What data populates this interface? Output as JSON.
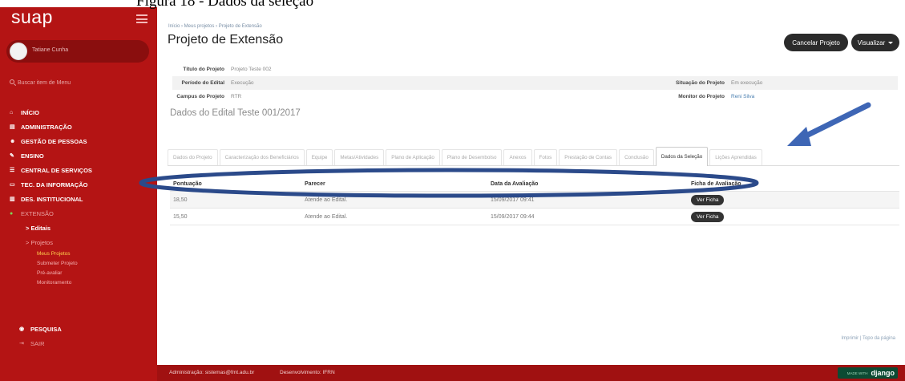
{
  "caption": "Figura 18 - Dados da seleção",
  "sidebar": {
    "logo": "suap",
    "user_name": "Tatiane Cunha",
    "search_placeholder": "Buscar item de Menu",
    "menu": [
      {
        "label": "INÍCIO",
        "icon": "home-icon"
      },
      {
        "label": "ADMINISTRAÇÃO",
        "icon": "admin-icon"
      },
      {
        "label": "GESTÃO DE PESSOAS",
        "icon": "people-icon"
      },
      {
        "label": "ENSINO",
        "icon": "pencil-icon"
      },
      {
        "label": "CENTRAL DE SERVIÇOS",
        "icon": "services-icon"
      },
      {
        "label": "TEC. DA INFORMAÇÃO",
        "icon": "monitor-icon"
      },
      {
        "label": "DES. INSTITUCIONAL",
        "icon": "chart-icon"
      },
      {
        "label": "EXTENSÃO",
        "icon": "extension-icon"
      }
    ],
    "sub": {
      "editais": "> Editais",
      "projetos": "> Projetos"
    },
    "subsub": [
      "Meus Projetos",
      "Submeter Projeto",
      "Pré-avaliar",
      "Monitoramento"
    ],
    "pesquisa": "PESQUISA",
    "sair": "SAIR"
  },
  "main": {
    "breadcrumb": "Início › Meus projetos › Projeto de Extensão",
    "title": "Projeto de Extensão",
    "buttons": {
      "cancel": "Cancelar Projeto",
      "view": "Visualizar"
    },
    "info": {
      "titulo_label": "Título do Projeto",
      "titulo_val": "Projeto Teste 002",
      "periodo_label": "Período do Edital",
      "periodo_val": "Execução",
      "situacao_label": "Situação do Projeto",
      "situacao_val": "Em execução",
      "campus_label": "Campus do Projeto",
      "campus_val": "RTR",
      "monitor_label": "Monitor do Projeto",
      "monitor_val": "Reni Silva"
    },
    "section_title": "Dados do Edital Teste 001/2017",
    "tabs": [
      "Dados do Projeto",
      "Caracterização dos Beneficiários",
      "Equipe",
      "Metas/Atividades",
      "Plano de Aplicação",
      "Plano de Desembolso",
      "Anexos",
      "Fotos",
      "Prestação de Contas",
      "Conclusão",
      "Dados da Seleção",
      "Lições Aprendidas"
    ],
    "active_tab": "Dados da Seleção",
    "table": {
      "headers": [
        "Pontuação",
        "Parecer",
        "Data da Avaliação",
        "Ficha de Avaliação"
      ],
      "rows": [
        {
          "pontuacao": "18,50",
          "parecer": "Atende ao Edital.",
          "data": "15/09/2017 09:41",
          "ficha": "Ver Ficha"
        },
        {
          "pontuacao": "15,50",
          "parecer": "Atende ao Edital.",
          "data": "15/09/2017 09:44",
          "ficha": "Ver Ficha"
        }
      ]
    },
    "footer_links": "Imprimir | Topo da página"
  },
  "footer": {
    "admin": "Administração: sistemas@fmt.adu.br",
    "dev": "Desenvolvimento: IFRN",
    "django_small": "MADE WITH",
    "django_label": "django"
  },
  "colors": {
    "sidebar": "#b41414",
    "annotation": "#2b4a8a"
  }
}
